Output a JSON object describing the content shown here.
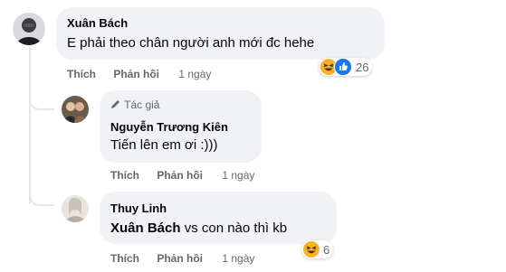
{
  "comments": [
    {
      "author": "Xuân Bách",
      "text": "E phải theo chân người anh mới đc hehe",
      "actions": {
        "like": "Thích",
        "reply": "Phản hồi",
        "time": "1 ngày"
      },
      "reactions": {
        "count": "26",
        "icons": [
          "haha-emoji-icon",
          "like-icon"
        ]
      }
    }
  ],
  "replies": [
    {
      "badge": "Tác giả",
      "author": "Nguyễn Trương Kiên",
      "text": "Tiến lên em ơi :)))",
      "actions": {
        "like": "Thích",
        "reply": "Phản hồi",
        "time": "1 ngày"
      }
    },
    {
      "author": "Thuy Linh",
      "mention": "Xuân Bách",
      "text": " vs con nào thì kb",
      "actions": {
        "like": "Thích",
        "reply": "Phản hồi",
        "time": "1 ngày"
      },
      "reactions": {
        "count": "6",
        "icons": [
          "haha-emoji-icon"
        ]
      }
    }
  ],
  "colors": {
    "bubble": "#f0f2f5",
    "meta": "#65676b",
    "like_blue": "#1877f2",
    "haha_yellow": "#f7b125"
  }
}
